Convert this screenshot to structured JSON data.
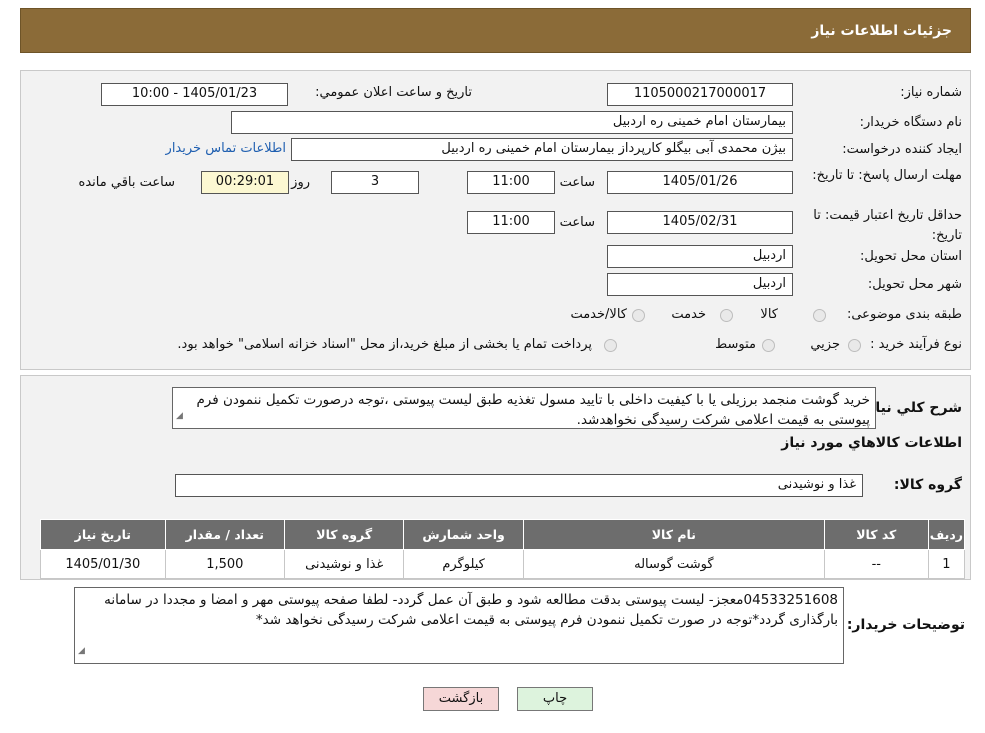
{
  "header": {
    "title": "جزئیات اطلاعات نیاز"
  },
  "watermark": {
    "text": "AriaTender.neT"
  },
  "form": {
    "need_number_label": "شماره نیاز:",
    "need_number": "1105000217000017",
    "announce_label": "تاريخ و ساعت اعلان عمومي:",
    "announce_value": "1405/01/23 - 10:00",
    "buyer_org_label": "نام دستگاه خريدار:",
    "buyer_org": "بیمارستان امام خمینی  ره  اردبیل",
    "creator_label": "ايجاد کننده درخواست:",
    "creator": "بیژن محمدی آبی بیگلو کارپرداز بیمارستان امام خمینی  ره  اردبیل",
    "contact_link": "اطلاعات تماس خريدار",
    "deadline_label": "مهلت ارسال پاسخ: تا تاريخ:",
    "deadline_date": "1405/01/26",
    "time_label": "ساعت",
    "deadline_time": "11:00",
    "days_value": "3",
    "days_label": "روز و",
    "remaining_time": "00:29:01",
    "remaining_label": "ساعت باقي مانده",
    "validity_label": "حداقل تاريخ اعتبار قيمت: تا تاريخ:",
    "validity_date": "1405/02/31",
    "validity_time": "11:00",
    "province_label": "استان محل تحويل:",
    "province": "اردبیل",
    "city_label": "شهر محل تحويل:",
    "city": "اردبیل",
    "category_label": "طبقه بندی موضوعی:",
    "category_options": [
      "کالا",
      "خدمت",
      "کالا/خدمت"
    ],
    "process_label": "نوع فرآيند خريد :",
    "process_options": [
      "جزيي",
      "متوسط"
    ],
    "process_note": "پرداخت تمام يا بخشی از مبلغ خريد،از محل \"اسناد خزانه اسلامی\" خواهد بود."
  },
  "summary": {
    "label": "شرح کلي نياز:",
    "text": "خرید گوشت منجمد برزیلی یا با کیفیت داخلی با تایید مسول تغذیه طبق لیست پیوستی ،توجه درصورت تکمیل ننمودن فرم پیوستی به قیمت اعلامی شرکت رسیدگی نخواهدشد.",
    "goods_info_title": "اطلاعات کالاهاي مورد نياز",
    "group_label": "گروه کالا:",
    "group_value": "غذا و نوشیدنی"
  },
  "table": {
    "headers": [
      "رديف",
      "کد کالا",
      "نام کالا",
      "واحد شمارش",
      "گروه کالا",
      "تعداد / مقدار",
      "تاريخ نياز"
    ],
    "rows": [
      [
        "1",
        "--",
        "گوشت گوساله",
        "کیلوگرم",
        "غذا و نوشیدنی",
        "1,500",
        "1405/01/30"
      ]
    ]
  },
  "buyer_notes": {
    "label": "توضيحات خريدار:",
    "text": "04533251608معجز- لیست پیوستی بدقت مطالعه شود و طبق آن عمل گردد- لطفا صفحه پیوستی مهر و امضا و مجددا در سامانه بارگذاری گردد*توجه در صورت تکمیل ننمودن فرم پیوستی به قیمت اعلامی شرکت رسیدگی نخواهد شد*"
  },
  "buttons": {
    "print": "چاپ",
    "back": "بازگشت"
  },
  "colors": {
    "header_bg": "#8b6b38",
    "table_header_bg": "#6d6d6d",
    "remaining_bg": "#fcf8d2",
    "back_btn_bg": "#f6d7d7",
    "print_btn_bg": "#ddf3dd",
    "link": "#1f5fb0"
  }
}
